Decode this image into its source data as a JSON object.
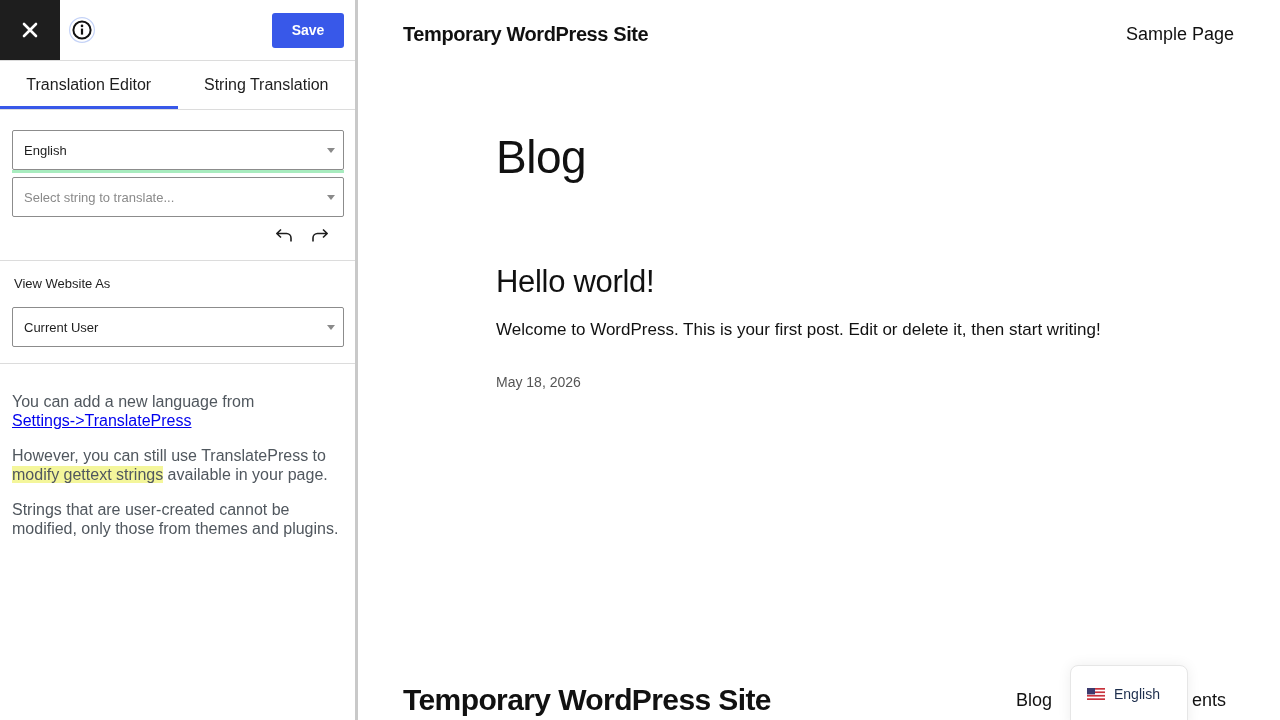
{
  "editor_panel": {
    "save_button": {
      "label": "Save"
    },
    "tabs": [
      {
        "label": "Translation Editor",
        "selected": true
      },
      {
        "label": "String Translation",
        "selected": false
      }
    ],
    "language_select": {
      "value": "English"
    },
    "string_select": {
      "placeholder": "Select string to translate..."
    },
    "view_as": {
      "label": "View Website As",
      "value": "Current User"
    },
    "notes": [
      {
        "parts": [
          {
            "kind": "text",
            "text": "You can add a new language from "
          },
          {
            "kind": "link",
            "text": "Settings->TranslatePress"
          }
        ]
      },
      {
        "parts": [
          {
            "kind": "text",
            "text": "However, you can still use TranslatePress to "
          },
          {
            "kind": "highlight",
            "text": "modify gettext strings"
          },
          {
            "kind": "text",
            "text": " available in your page."
          }
        ]
      },
      {
        "parts": [
          {
            "kind": "text",
            "text": "Strings that are user-created cannot be modified, only those from themes and plugins."
          }
        ]
      }
    ]
  },
  "site_preview": {
    "header": {
      "site_title": "Temporary WordPress Site",
      "nav": [
        "Sample Page"
      ]
    },
    "page_title": "Blog",
    "posts": [
      {
        "title": "Hello world!",
        "excerpt": "Welcome to WordPress. This is your first post. Edit or delete it, then start writing!",
        "date": "May 18, 2026"
      }
    ],
    "footer": {
      "site_title": "Temporary WordPress Site",
      "nav": [
        "Blog",
        "ents"
      ]
    },
    "language_switcher": {
      "current": "English"
    }
  }
}
